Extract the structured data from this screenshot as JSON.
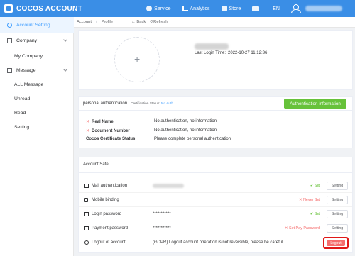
{
  "header": {
    "brand": "COCOS ACCOUNT",
    "nav": [
      "Service",
      "Analytics",
      "Store"
    ],
    "lang": "EN",
    "accent_color": "#3a8ee6"
  },
  "sidebar": {
    "account_setting": "Account Setting",
    "company": "Company",
    "my_company": "My Company",
    "message": "Message",
    "all_message": "ALL Message",
    "unread": "Unread",
    "read": "Read",
    "setting": "Setting"
  },
  "breadcrumb": {
    "account": "Account",
    "sep": "/",
    "profile": "Profile",
    "back": "← Back",
    "refresh": "⟳Refresh"
  },
  "profile": {
    "avatar_plus": "+",
    "last_login_label": "Last Login Time:",
    "last_login_value": "2022-10-27 11:12:36"
  },
  "auth": {
    "title": "personal authentication",
    "cert_label": "Certification Status:",
    "cert_value": "No Auth",
    "button": "Authentication information",
    "rows": [
      {
        "mark": "✕",
        "label": "Real Name",
        "value": "No authentication, no information"
      },
      {
        "mark": "✕",
        "label": "Document Number",
        "value": "No authentication, no information"
      },
      {
        "mark": "",
        "label": "Cocos Certificate Status",
        "value": "Please complete personal authentication"
      }
    ]
  },
  "safe": {
    "title": "Account Safe",
    "rows": [
      {
        "label": "Mail authentication",
        "value": "",
        "status": "✔ Set",
        "button": "Setting"
      },
      {
        "label": "Mobile binding",
        "value": "",
        "status": "✕ Never Set",
        "button": "Setting"
      },
      {
        "label": "Login password",
        "value": "***********",
        "status": "✔ Set",
        "button": "Setting"
      },
      {
        "label": "Payment password",
        "value": "***********",
        "status": "✕ Set Pay Password",
        "button": "Setting"
      },
      {
        "label": "Logout of account",
        "value": "(GDPR) Logout account operation is not reversible, please be careful",
        "status": "",
        "button": "Logout"
      }
    ],
    "icons": [
      "mail-icon",
      "mobile-icon",
      "lock-icon",
      "payment-icon",
      "logout-icon"
    ]
  }
}
